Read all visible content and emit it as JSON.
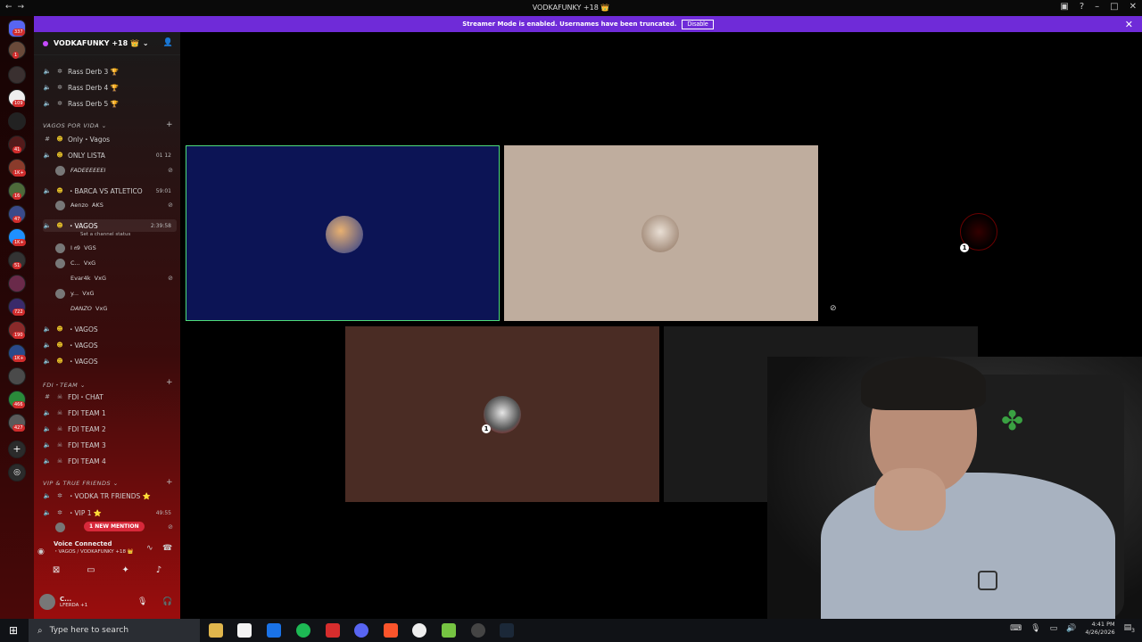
{
  "titlebar": {
    "title": "VODKAFUNKY +18 👑"
  },
  "banner": {
    "text": "Streamer Mode is enabled. Usernames have been truncated.",
    "button": "Disable"
  },
  "rail": {
    "badges": [
      "337",
      "1",
      "109",
      "1K+",
      "41",
      "16",
      "47",
      "1K+",
      "51",
      "722",
      "190",
      "1K+",
      "466",
      "427"
    ]
  },
  "server": {
    "name": "VODKAFUNKY +18 👑"
  },
  "channels": {
    "rass": [
      "Rass Derb 3 🏆",
      "Rass Derb 4 🏆",
      "Rass Derb 5 🏆"
    ],
    "cat_vagos": "VAGOS POR VIDA",
    "only_vagos": "Only・Vagos",
    "only_lista": "ONLY LISTA",
    "only_lista_counts": "01 12",
    "user_fadeee": "FADEEEEEEI",
    "barca": "・BARCA VS ATLETICO",
    "barca_time": "59:01",
    "user_aenzo": "Aenzo",
    "user_aenzo_tag": "AKS",
    "vagos_main": "・VAGOS",
    "vagos_time": "2:39:58",
    "vagos_status": "Set a channel status",
    "vagos_users": [
      {
        "name": "I 𝔞9",
        "tag": "VGS"
      },
      {
        "name": "C...",
        "tag": "VxG"
      },
      {
        "name": "Evar4k",
        "tag": "VxG"
      },
      {
        "name": "y...",
        "tag": "VxG"
      },
      {
        "name": "DANZO",
        "tag": "VxG"
      }
    ],
    "vagos_more": [
      "・VAGOS",
      "・VAGOS",
      "・VAGOS"
    ],
    "cat_fdi": "FDI・TEAM",
    "fdi": [
      "FDI・CHAT",
      "FDI TEAM 1",
      "FDI TEAM 2",
      "FDI TEAM 3",
      "FDI TEAM 4"
    ],
    "cat_vip": "VIP & TRUE FRIENDS",
    "vodka_tr": "・VODKA TR FRIENDS ⭐",
    "vip1": "・VIP 1 ⭐",
    "vip1_time": "49:55",
    "mention": "1 NEW MENTION"
  },
  "voice": {
    "status": "Voice Connected",
    "channel": "・VAGOS / VODKAFUNKY +18 👑"
  },
  "user": {
    "name": "C...",
    "sub": "LFERDA +1"
  },
  "tiles": {
    "badge": "1"
  },
  "taskbar": {
    "search": "Type here to search",
    "time": "4:41 PM",
    "date": "4/26/2026",
    "notif": "3"
  }
}
